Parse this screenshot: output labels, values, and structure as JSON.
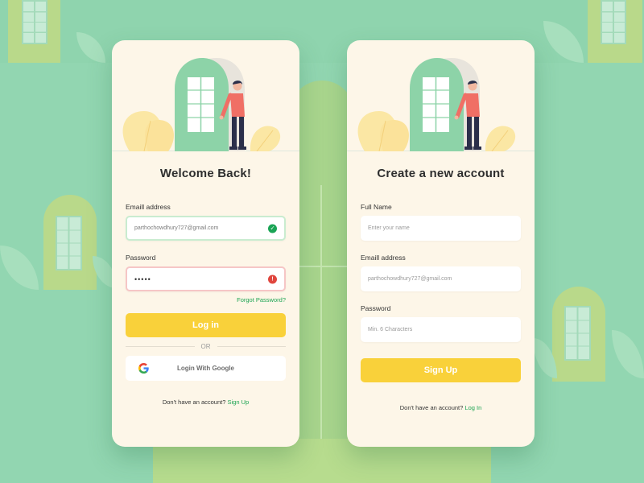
{
  "login": {
    "title": "Welcome Back!",
    "email_label": "Emaill address",
    "email_value": "parthochowdhury727@gmail.com",
    "email_status": "valid",
    "password_label": "Password",
    "password_value": "•••••",
    "password_status": "error",
    "forgot_password": "Forgot Password?",
    "login_button": "Log in",
    "divider_text": "OR",
    "google_button": "Login With Google",
    "footer_text": "Don't have an account?",
    "footer_link": "Sign Up"
  },
  "signup": {
    "title": "Create a new account",
    "fullname_label": "Full Name",
    "fullname_placeholder": "Enter your name",
    "email_label": "Emaill address",
    "email_placeholder": "parthochowdhury727@gmail.com",
    "password_label": "Password",
    "password_placeholder": "Min. 6 Characters",
    "signup_button": "Sign Up",
    "footer_text": "Don't have an account?",
    "footer_link": "Log In"
  },
  "colors": {
    "background": "#92d6b1",
    "card": "#fdf6e8",
    "accent_yellow": "#f9d13a",
    "link_green": "#1ea453",
    "success_green": "#1aa455",
    "error_red": "#e0463e"
  },
  "icons": {
    "valid": "check-circle-icon",
    "error": "exclamation-circle-icon",
    "google": "google-logo-icon"
  }
}
